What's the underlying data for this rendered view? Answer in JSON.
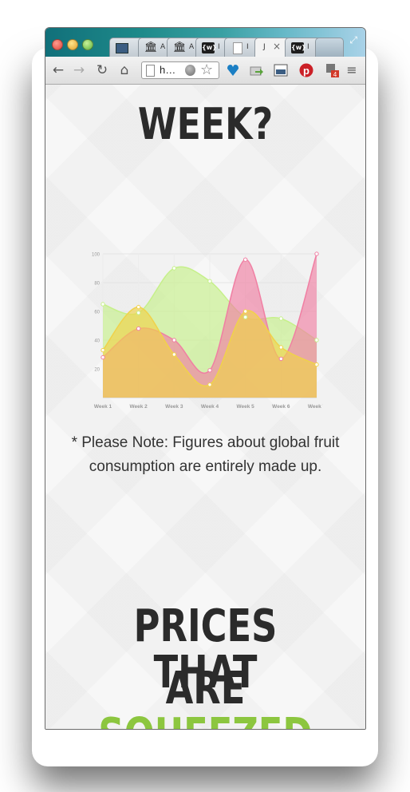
{
  "browser": {
    "tabs": [
      {
        "icon": "image-icon",
        "label": ""
      },
      {
        "icon": "bank-icon",
        "label": "A"
      },
      {
        "icon": "bank-icon",
        "label": "A"
      },
      {
        "icon": "wiki-icon",
        "label": "I"
      },
      {
        "icon": "page-icon",
        "label": "I"
      },
      {
        "icon": "blank",
        "label": "J"
      },
      {
        "icon": "wiki-icon",
        "label": "I"
      }
    ],
    "address": "h…",
    "wiki_glyph": "{w}"
  },
  "page": {
    "heading_top": "WEEK?",
    "note": "* Please Note: Figures about global fruit consumption are entirely made up.",
    "heading_bottom_line1": "PRICES THAT",
    "heading_bottom_line2_plain": "ARE",
    "heading_bottom_line2_accent": "SQUEEZED",
    "accent_color": "#8cc63f"
  },
  "chart_data": {
    "type": "area",
    "categories": [
      "Week 1",
      "Week 2",
      "Week 3",
      "Week 4",
      "Week 5",
      "Week 6",
      "Week 7"
    ],
    "y_ticks": [
      20,
      40,
      60,
      80,
      100
    ],
    "ylim": [
      0,
      100
    ],
    "grid": true,
    "series": [
      {
        "values": [
          65,
          59,
          90,
          81,
          56,
          55,
          40
        ],
        "color": "#c6f08a"
      },
      {
        "values": [
          28,
          48,
          40,
          19,
          96,
          27,
          100
        ],
        "color": "#f07fa3"
      },
      {
        "values": [
          33,
          63,
          30,
          9,
          60,
          35,
          23
        ],
        "color": "#f0d24a"
      }
    ]
  }
}
